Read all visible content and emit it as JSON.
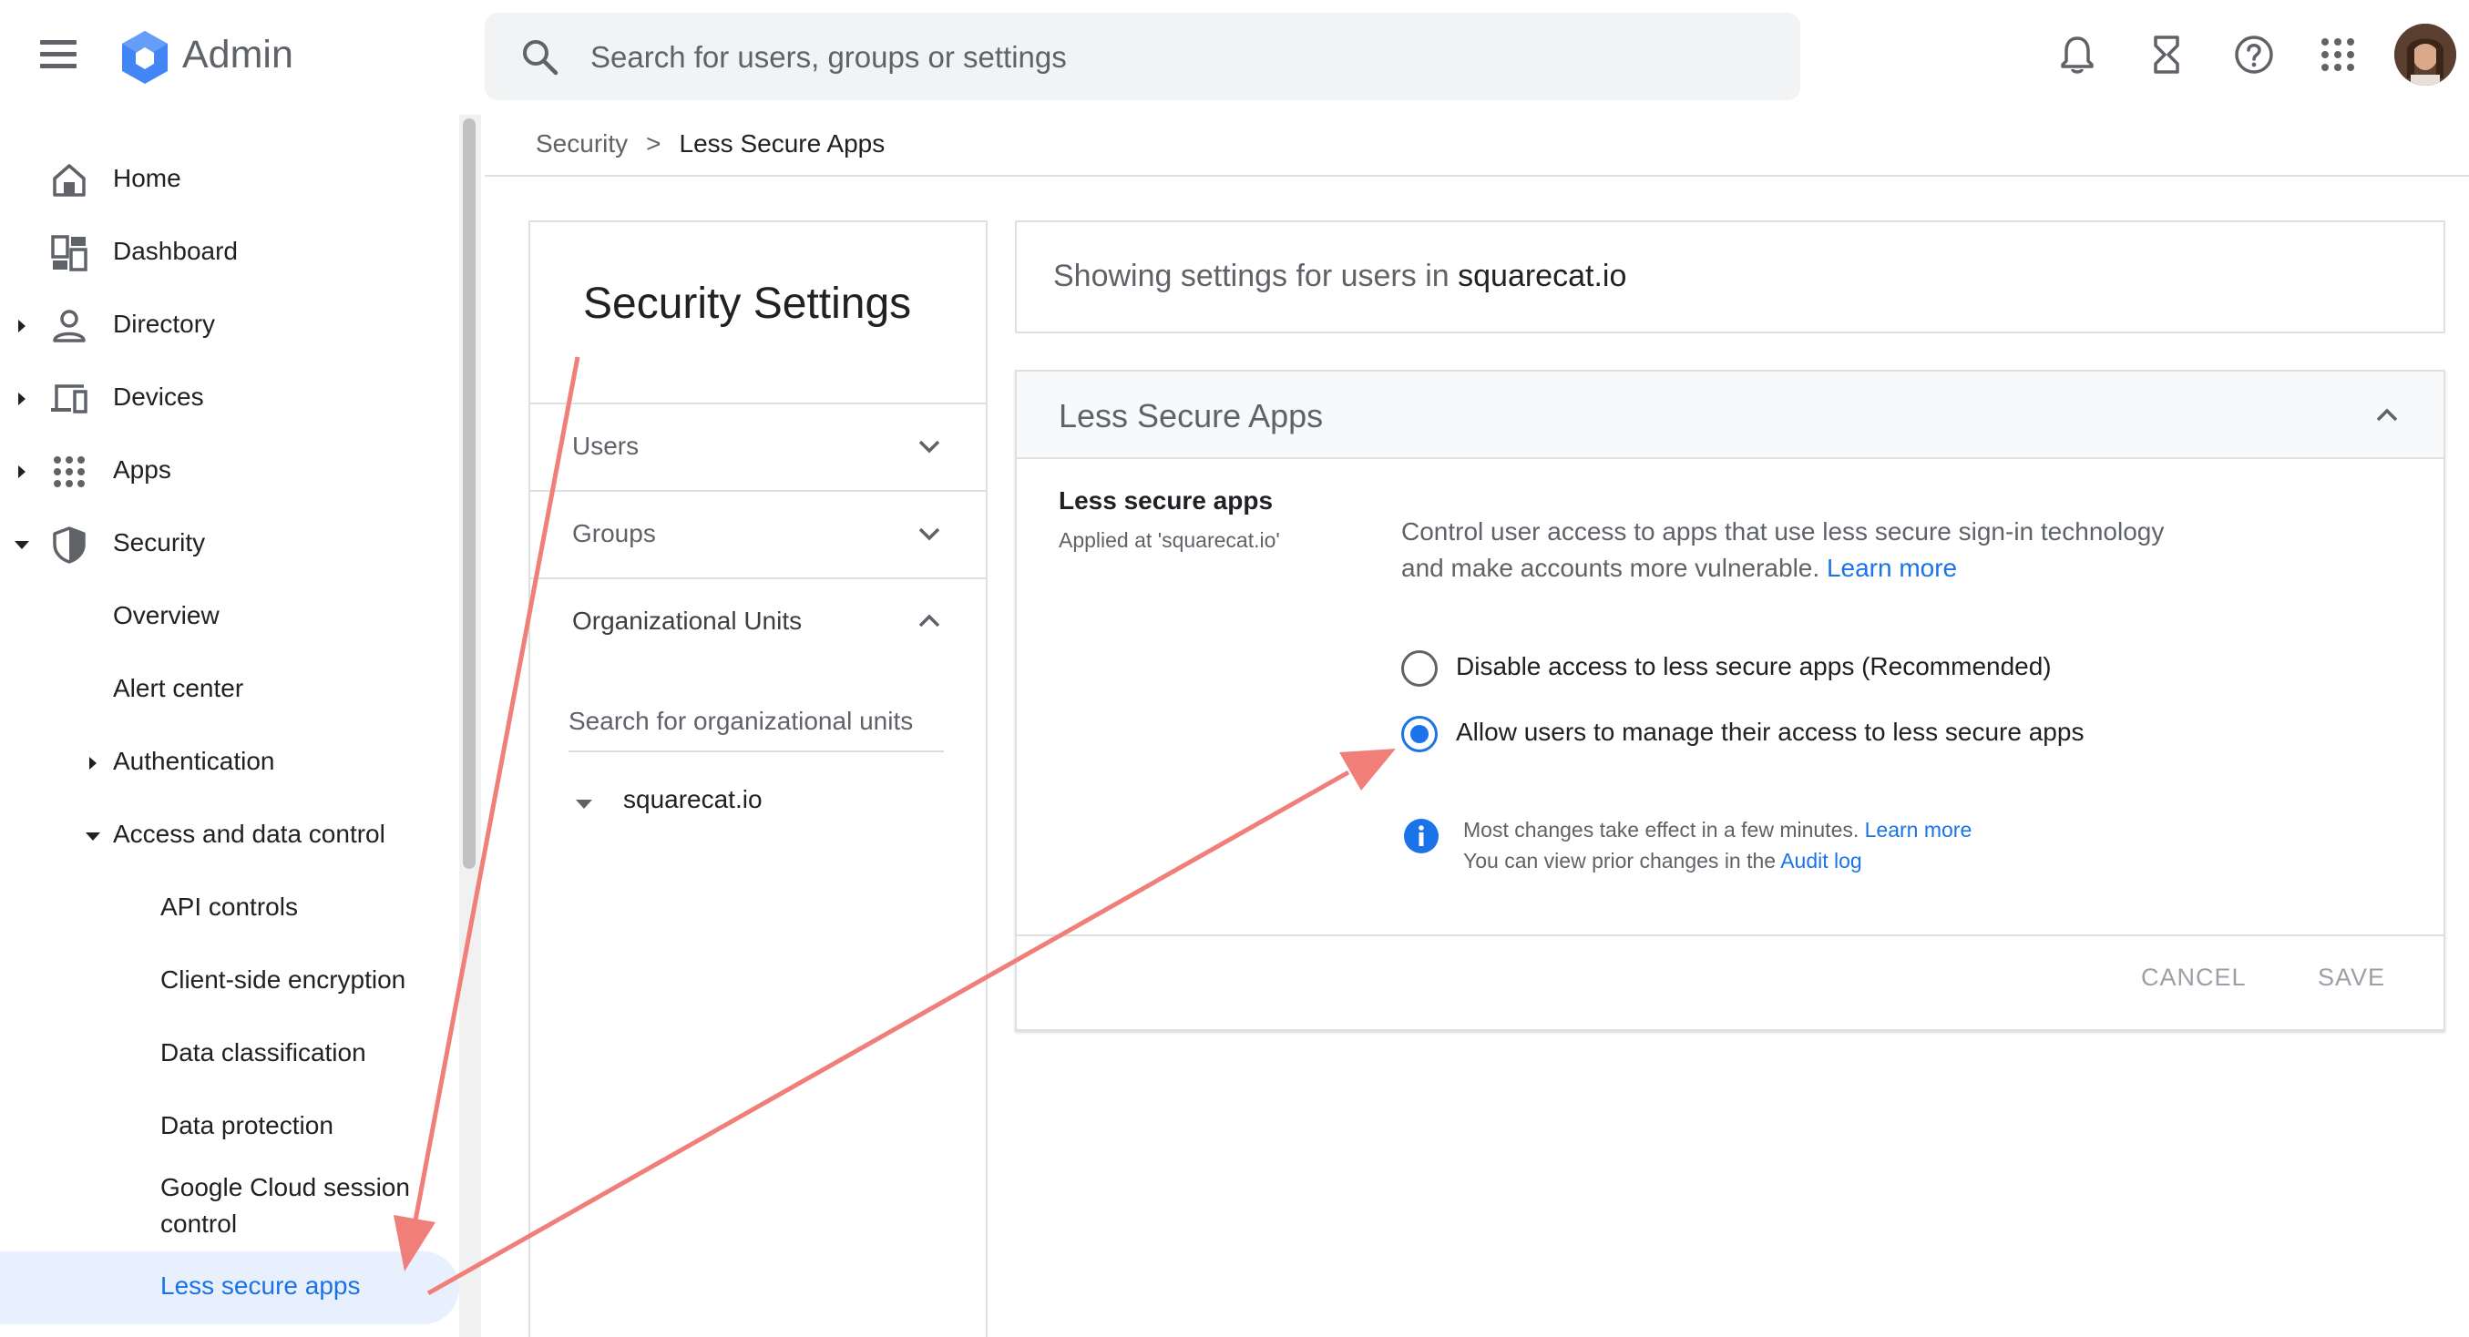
{
  "app": {
    "name": "Admin"
  },
  "search": {
    "placeholder": "Search for users, groups or settings"
  },
  "topbar_icons": [
    "bell-icon",
    "hourglass-icon",
    "help-icon",
    "apps-grid-icon",
    "avatar"
  ],
  "nav": {
    "home": "Home",
    "dashboard": "Dashboard",
    "directory": "Directory",
    "devices": "Devices",
    "apps": "Apps",
    "security": "Security",
    "overview": "Overview",
    "alert_center": "Alert center",
    "authentication": "Authentication",
    "access_data_control": "Access and data control",
    "api_controls": "API controls",
    "client_side_encryption": "Client-side encryption",
    "data_classification": "Data classification",
    "data_protection": "Data protection",
    "gcloud_session_line1": "Google Cloud session",
    "gcloud_session_line2": "control",
    "less_secure_apps": "Less secure apps"
  },
  "breadcrumb": {
    "parent": "Security",
    "separator": ">",
    "current": "Less Secure Apps"
  },
  "settings_panel": {
    "title": "Security Settings",
    "users": "Users",
    "groups": "Groups",
    "org_units": "Organizational Units",
    "ou_search_placeholder": "Search for organizational units",
    "ou_root": "squarecat.io"
  },
  "showing": {
    "prefix": "Showing settings for users in",
    "org": "squarecat.io"
  },
  "lsa": {
    "header": "Less Secure Apps",
    "setting_label": "Less secure apps",
    "applied_at": "Applied at 'squarecat.io'",
    "description": "Control user access to apps that use less secure sign-in technology and make accounts more vulnerable.",
    "learn_more": "Learn more",
    "options": [
      {
        "label": "Disable access to less secure apps (Recommended)",
        "selected": false
      },
      {
        "label": "Allow users to manage their access to less secure apps",
        "selected": true
      }
    ],
    "info_line1": "Most changes take effect in a few minutes.",
    "info_learn_more": "Learn more",
    "info_line2": "You can view prior changes in the",
    "audit_log": "Audit log",
    "cancel": "CANCEL",
    "save": "SAVE"
  },
  "colors": {
    "accent": "#1a73e8",
    "nav_active_bg": "#e8f0fe",
    "annotation_arrow": "#f07f7a",
    "logo": "#4285f4"
  }
}
